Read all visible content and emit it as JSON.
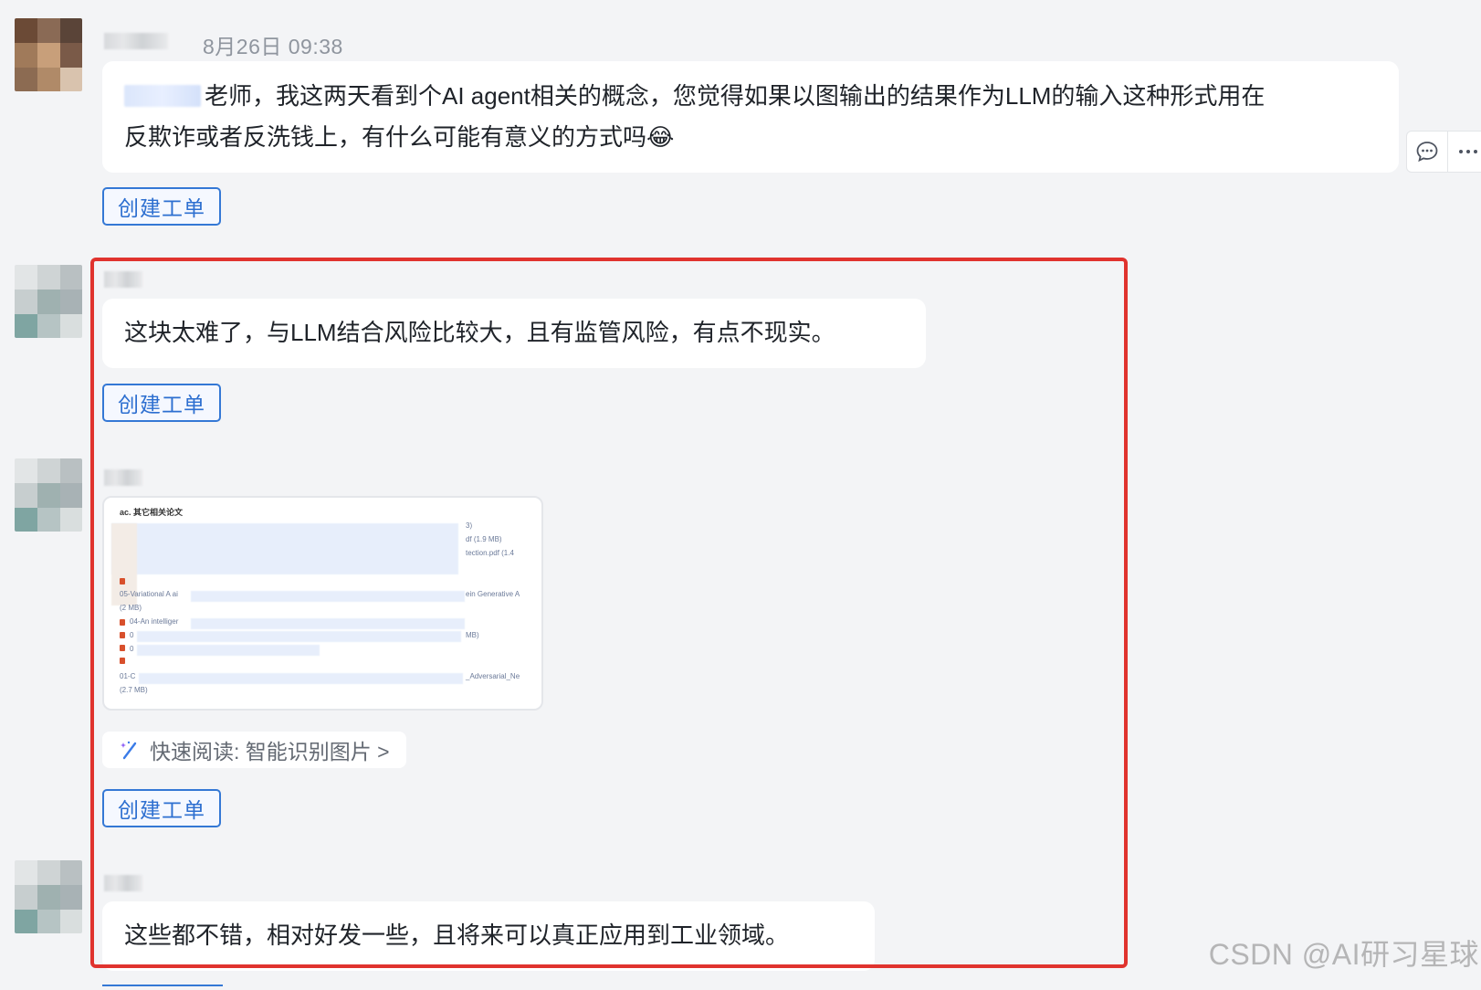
{
  "messages": [
    {
      "timestamp": "8月26日 09:38",
      "text_line1": "老师，我这两天看到个AI agent相关的概念，您觉得如果以图输出的结果作为LLM的输入这种形式用在",
      "text_line2": "反欺诈或者反洗钱上，有什么可能有意义的方式吗",
      "emoji": "😂",
      "ticket_button": "创建工单"
    },
    {
      "text": "这块太难了，与LLM结合风险比较大，且有监管风险，有点不现实。",
      "ticket_button": "创建工单"
    },
    {
      "image_card": {
        "heading": "ac. 其它相关论文",
        "lines": [
          "3)",
          "df  (1.9 MB)",
          "tection.pdf  (1.4",
          "05-Variational A ai",
          "ein Generative A",
          "(2 MB)",
          "04-An intelliger",
          "0",
          "MB)",
          "0",
          "01-C",
          "_Adversarial_Ne",
          "(2.7 MB)"
        ]
      },
      "quick_read": "快速阅读: 智能识别图片 >",
      "ticket_button": "创建工单"
    },
    {
      "text": "这些都不错，相对好发一些，且将来可以真正应用到工业领域。"
    }
  ],
  "side_actions": {
    "reply_icon": "comment-bubble-icon",
    "more_icon": "more-dots-icon"
  },
  "watermark": "CSDN @AI研习星球",
  "colors": {
    "accent": "#3478d5",
    "highlight": "#e0332e",
    "background": "#f3f4f6",
    "bubble": "#ffffff",
    "timestamp": "#8f959e"
  }
}
